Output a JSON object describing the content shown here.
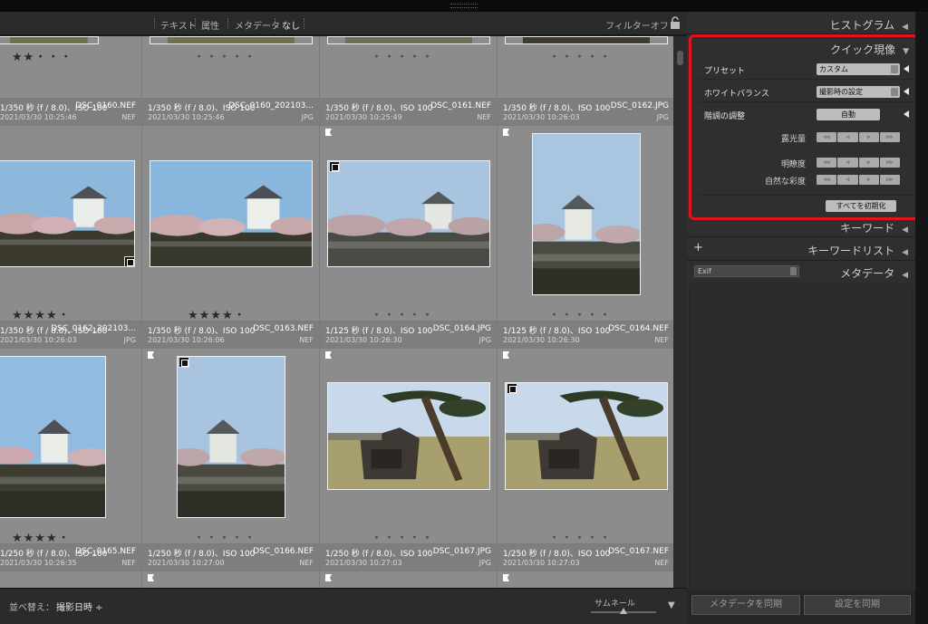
{
  "filter_bar": {
    "items": [
      "テキスト",
      "属性",
      "メタデータ",
      "なし"
    ],
    "filter_off": "フィルターオフ ÷"
  },
  "grid": {
    "rows": [
      {
        "stars": [
          "★★・・・",
          "・・・・・",
          "・・・・・",
          "・・・・・"
        ]
      },
      {
        "cells": [
          {
            "exposure": "1/350 秒 (f / 8.0)、ISO 100",
            "filename": "DSC_0160.NEF",
            "date": "2021/03/30 10:25:46",
            "ext": "NEF"
          },
          {
            "exposure": "1/350 秒 (f / 8.0)、ISO 100",
            "filename": "DSC_0160_202103...",
            "date": "2021/03/30 10:25:46",
            "ext": "JPG"
          },
          {
            "exposure": "1/350 秒 (f / 8.0)、ISO 100",
            "filename": "DSC_0161.NEF",
            "date": "2021/03/30 10:25:49",
            "ext": "NEF"
          },
          {
            "exposure": "1/350 秒 (f / 8.0)、ISO 100",
            "filename": "DSC_0162.JPG",
            "date": "2021/03/30 10:26:03",
            "ext": "JPG"
          }
        ],
        "stars": [
          "★★★★・",
          "★★★★・",
          "・・・・・",
          "・・・・・"
        ]
      },
      {
        "cells": [
          {
            "exposure": "1/350 秒 (f / 8.0)、ISO 100",
            "filename": "DSC_0162_202103...",
            "date": "2021/03/30 10:26:03",
            "ext": "JPG"
          },
          {
            "exposure": "1/350 秒 (f / 8.0)、ISO 100",
            "filename": "DSC_0163.NEF",
            "date": "2021/03/30 10:26:06",
            "ext": "NEF"
          },
          {
            "exposure": "1/125 秒 (f / 8.0)、ISO 100",
            "filename": "DSC_0164.JPG",
            "date": "2021/03/30 10:26:30",
            "ext": "JPG"
          },
          {
            "exposure": "1/125 秒 (f / 8.0)、ISO 100",
            "filename": "DSC_0164.NEF",
            "date": "2021/03/30 10:26:30",
            "ext": "NEF"
          }
        ],
        "stars": [
          "★★★★・",
          "・・・・・",
          "・・・・・",
          "・・・・・"
        ]
      },
      {
        "cells": [
          {
            "exposure": "1/250 秒 (f / 8.0)、ISO 100",
            "filename": "DSC_0165.NEF",
            "date": "2021/03/30 10:26:35",
            "ext": "NEF"
          },
          {
            "exposure": "1/250 秒 (f / 8.0)、ISO 100",
            "filename": "DSC_0166.NEF",
            "date": "2021/03/30 10:27:00",
            "ext": "NEF"
          },
          {
            "exposure": "1/250 秒 (f / 8.0)、ISO 100",
            "filename": "DSC_0167.JPG",
            "date": "2021/03/30 10:27:03",
            "ext": "JPG"
          },
          {
            "exposure": "1/250 秒 (f / 8.0)、ISO 100",
            "filename": "DSC_0167.NEF",
            "date": "2021/03/30 10:27:03",
            "ext": "NEF"
          }
        ]
      }
    ]
  },
  "toolbar": {
    "sort_label": "並べ替え：",
    "sort_value": "撮影日時 ÷",
    "thumb_label": "サムネール",
    "thumbnail_size": 0.45
  },
  "right_panel": {
    "histogram": "ヒストグラム",
    "quick_develop": {
      "title": "クイック現像",
      "preset_label": "プリセット",
      "preset_value": "カスタム",
      "wb_label": "ホワイトバランス",
      "wb_value": "撮影時の設定",
      "tone_label": "階調の調整",
      "auto_label": "自動",
      "exposure_label": "露光量",
      "clarity_label": "明瞭度",
      "vibrance_label": "自然な彩度",
      "reset_label": "すべてを初期化",
      "stepper_glyphs": [
        "◃◃",
        "◃",
        "▹",
        "▹▹"
      ]
    },
    "keywording": "キーワード",
    "keyword_list": "キーワードリスト",
    "exif_select": "Exif",
    "metadata": "メタデータ",
    "sync_metadata": "メタデータを同期",
    "sync_settings": "設定を同期"
  },
  "colors": {
    "highlight": "#e0141c",
    "panel": "#2f2f2f",
    "grid": "#969696"
  }
}
